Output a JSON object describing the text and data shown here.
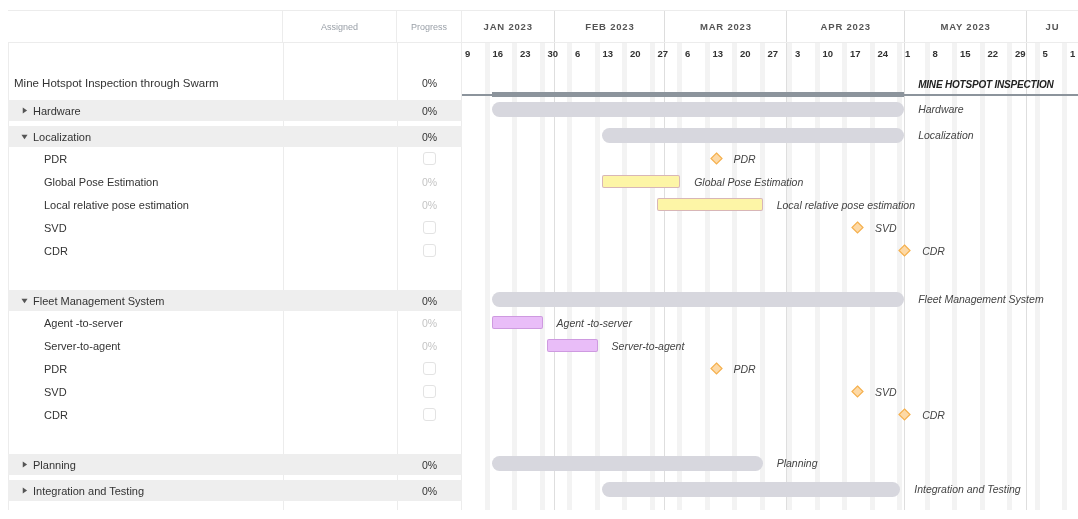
{
  "columns": {
    "assigned": "Assigned",
    "progress": "Progress"
  },
  "timeline": {
    "months": [
      {
        "label": "JAN 2023"
      },
      {
        "label": "FEB 2023"
      },
      {
        "label": "MAR 2023"
      },
      {
        "label": "APR 2023"
      },
      {
        "label": "MAY 2023"
      },
      {
        "label": "JU"
      }
    ],
    "weeks": [
      "9",
      "16",
      "23",
      "30",
      "6",
      "13",
      "20",
      "27",
      "6",
      "13",
      "20",
      "27",
      "3",
      "10",
      "17",
      "24",
      "1",
      "8",
      "15",
      "22",
      "29",
      "5",
      "1"
    ]
  },
  "project": {
    "name": "Mine Hotspot Inspection through Swarm",
    "progress": "0%",
    "bar_label": "MINE HOTSPOT INSPECTION"
  },
  "rows": [
    {
      "kind": "group",
      "name": "Hardware",
      "progress": "0%",
      "expanded": false,
      "bar_label": "Hardware"
    },
    {
      "kind": "group",
      "name": "Localization",
      "progress": "0%",
      "expanded": true,
      "bar_label": "Localization",
      "children": [
        {
          "kind": "milestone",
          "name": "PDR",
          "checked": false,
          "bar_label": "PDR"
        },
        {
          "kind": "task",
          "name": "Global Pose Estimation",
          "progress": "0%",
          "color": "#fdf5a6",
          "bar_label": "Global Pose Estimation"
        },
        {
          "kind": "task",
          "name": "Local relative pose estimation",
          "progress": "0%",
          "color": "#fdf5a6",
          "bar_label": "Local relative pose estimation"
        },
        {
          "kind": "milestone",
          "name": "SVD",
          "checked": false,
          "bar_label": "SVD"
        },
        {
          "kind": "milestone",
          "name": "CDR",
          "checked": false,
          "bar_label": "CDR"
        }
      ]
    },
    {
      "kind": "group",
      "name": "Fleet Management System",
      "progress": "0%",
      "expanded": true,
      "bar_label": "Fleet Management System",
      "children": [
        {
          "kind": "task",
          "name": "Agent -to-server",
          "progress": "0%",
          "color": "#e9bdf8",
          "bar_label": "Agent -to-server"
        },
        {
          "kind": "task",
          "name": "Server-to-agent",
          "progress": "0%",
          "color": "#e9bdf8",
          "bar_label": "Server-to-agent"
        },
        {
          "kind": "milestone",
          "name": "PDR",
          "checked": false,
          "bar_label": "PDR"
        },
        {
          "kind": "milestone",
          "name": "SVD",
          "checked": false,
          "bar_label": "SVD"
        },
        {
          "kind": "milestone",
          "name": "CDR",
          "checked": false,
          "bar_label": "CDR"
        }
      ]
    },
    {
      "kind": "group",
      "name": "Planning",
      "progress": "0%",
      "expanded": false,
      "bar_label": "Planning"
    },
    {
      "kind": "group",
      "name": "Integration and Testing",
      "progress": "0%",
      "expanded": false,
      "bar_label": "Integration and Testing"
    }
  ]
}
